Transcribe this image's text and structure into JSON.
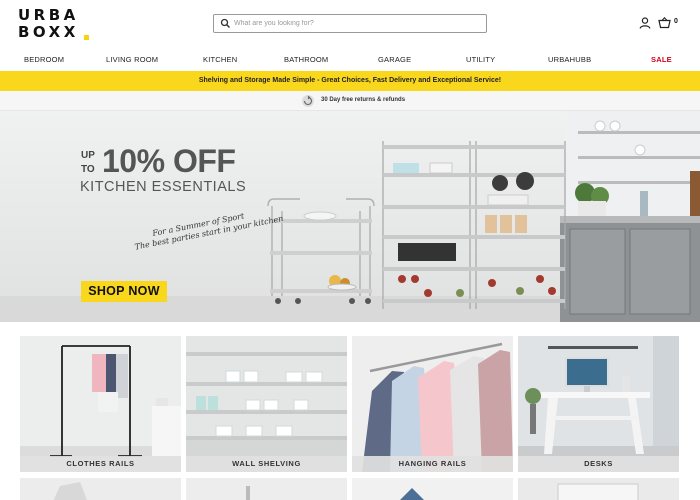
{
  "brand": {
    "line1": "URBA",
    "line2": "BOXX"
  },
  "search": {
    "placeholder": "What are you looking for?"
  },
  "header": {
    "cart_count": "0"
  },
  "nav": {
    "items": [
      "BEDROOM",
      "LIVING ROOM",
      "KITCHEN",
      "BATHROOM",
      "GARAGE",
      "UTILITY",
      "URBAHUBB",
      "SALE"
    ]
  },
  "promo": {
    "text": "Shelving and Storage Made Simple - Great Choices, Fast Delivery and Exceptional Service!"
  },
  "returns": {
    "text": "30 Day free returns & refunds"
  },
  "hero": {
    "up": "UP",
    "to": "TO",
    "percent": "10% OFF",
    "subtitle": "KITCHEN ESSENTIALS",
    "script_line1": "For a Summer of Sport",
    "script_line2": "The best parties start in your kitchen",
    "cta": "SHOP NOW",
    "slide_count": 3,
    "active_slide": 2
  },
  "categories": [
    "CLOTHES RAILS",
    "WALL SHELVING",
    "HANGING RAILS",
    "DESKS"
  ],
  "colors": {
    "accent": "#f9d71c",
    "sale": "#d0021b",
    "text": "#222222"
  }
}
